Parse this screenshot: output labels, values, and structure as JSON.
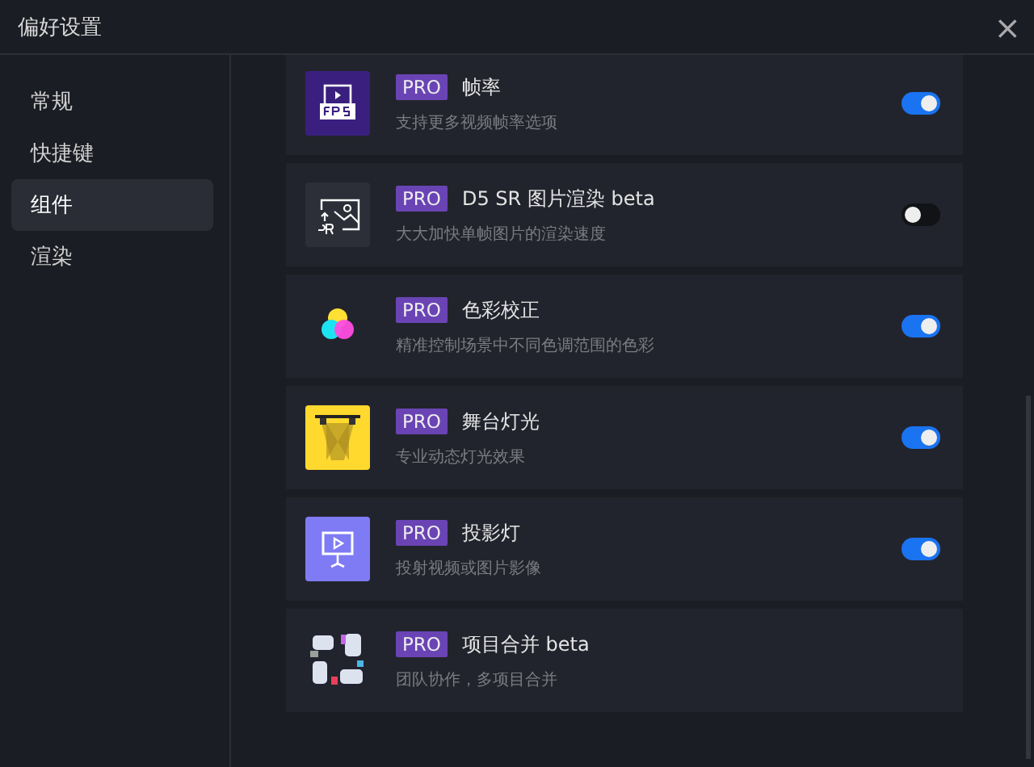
{
  "window": {
    "title": "偏好设置",
    "close": "×"
  },
  "sidebar": {
    "items": [
      {
        "label": "常规",
        "selected": false
      },
      {
        "label": "快捷键",
        "selected": false
      },
      {
        "label": "组件",
        "selected": true
      },
      {
        "label": "渲染",
        "selected": false
      }
    ]
  },
  "plugins": [
    {
      "kind": "toggle",
      "badge": "PRO",
      "title": "帧率",
      "description": "支持更多视频帧率选项",
      "on": true
    },
    {
      "kind": "toggle",
      "badge": "PRO",
      "title": "D5 SR 图片渲染 beta",
      "description": "大大加快单帧图片的渲染速度",
      "on": false
    },
    {
      "kind": "toggle",
      "badge": "PRO",
      "title": "色彩校正",
      "description": "精准控制场景中不同色调范围的色彩",
      "on": true
    },
    {
      "kind": "toggle",
      "badge": "PRO",
      "title": "舞台灯光",
      "description": "专业动态灯光效果",
      "on": true
    },
    {
      "kind": "toggle",
      "badge": "PRO",
      "title": "投影灯",
      "description": "投射视频或图片影像",
      "on": true
    },
    {
      "kind": "plain",
      "badge": "PRO",
      "title": "项目合并 beta",
      "description": "团队协作，多项目合并"
    }
  ]
}
